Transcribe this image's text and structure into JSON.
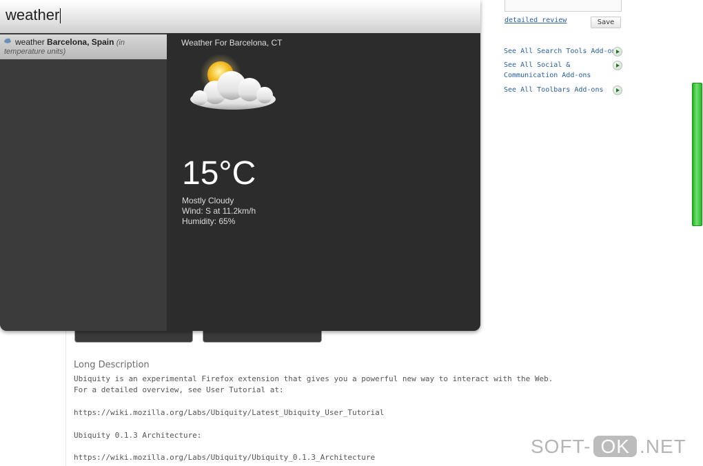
{
  "ubiquity": {
    "input_value": "weather",
    "suggestion": {
      "command": "weather",
      "location": "Barcelona, Spain",
      "hint_open": "(in",
      "hint_rest": "temperature units)"
    },
    "preview": {
      "title": "Weather For Barcelona, CT",
      "temperature": "15°C",
      "condition": "Mostly Cloudy",
      "wind": "Wind: S at 11.2km/h",
      "humidity": "Humidity: 65%",
      "icon": "partly-cloudy-icon"
    }
  },
  "sidebar": {
    "detailed_review": "detailed review",
    "save_label": "Save",
    "links": [
      "See All Search Tools Add-ons",
      "See All Social &",
      "Communication Add-ons",
      "See All Toolbars Add-ons"
    ]
  },
  "main": {
    "long_description_title": "Long Description",
    "lines": [
      "Ubiquity is an experimental Firefox extension that gives you a powerful new way to interact with the Web.",
      "For a detailed overview, see User Tutorial at:",
      "https://wiki.mozilla.org/Labs/Ubiquity/Latest_Ubiquity_User_Tutorial",
      "Ubiquity 0.1.3 Architecture:",
      "https://wiki.mozilla.org/Labs/Ubiquity/Ubiquity_0.1.3_Architecture"
    ]
  },
  "watermark": {
    "left": "SOFT-",
    "mid": "OK",
    "right": ".NET"
  }
}
